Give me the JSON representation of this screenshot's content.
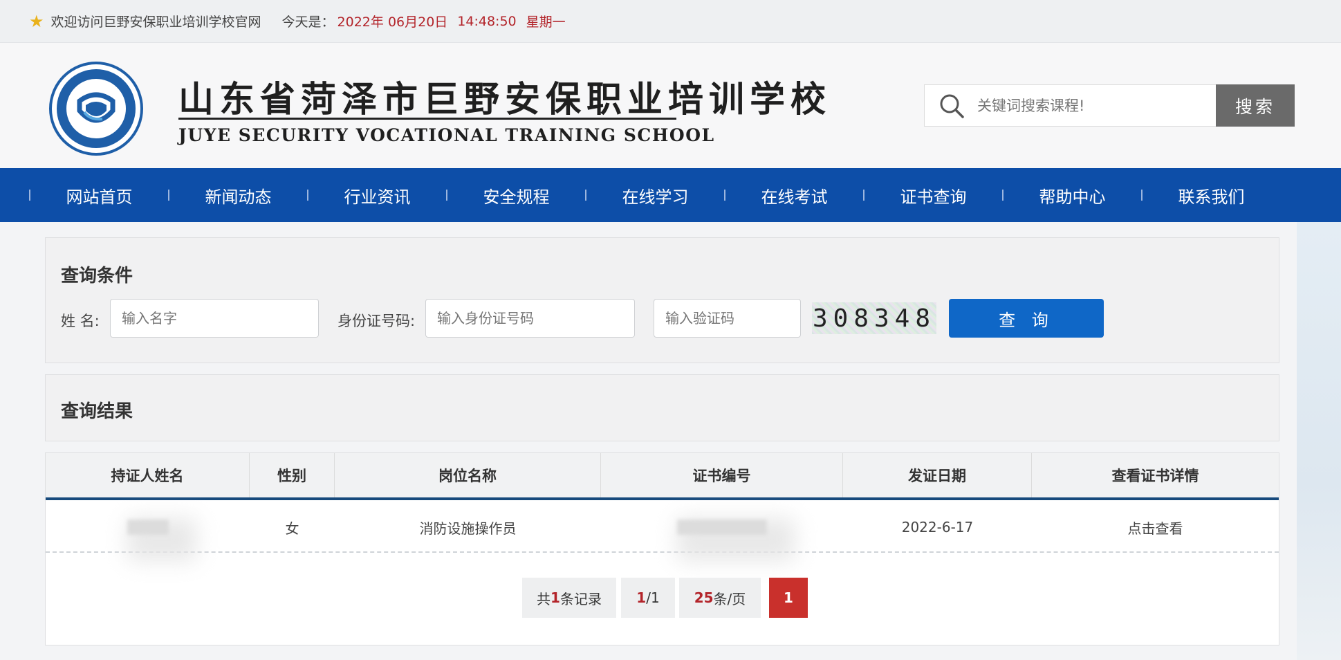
{
  "topbar": {
    "welcome": "欢迎访问巨野安保职业培训学校官网",
    "today_label": "今天是：",
    "date": "2022年 06月20日",
    "time": "14:48:50",
    "weekday": "星期一"
  },
  "header": {
    "school_name_cn": "山东省菏泽市巨野安保职业培训学校",
    "school_name_en": "JUYE SECURITY VOCATIONAL TRAINING SCHOOL",
    "search_placeholder": "关键词搜索课程!",
    "search_button": "搜索"
  },
  "nav": {
    "items": [
      "网站首页",
      "新闻动态",
      "行业资讯",
      "安全规程",
      "在线学习",
      "在线考试",
      "证书查询",
      "帮助中心",
      "联系我们"
    ]
  },
  "query": {
    "title": "查询条件",
    "name_label": "姓 名:",
    "name_placeholder": "输入名字",
    "id_label": "身份证号码:",
    "id_placeholder": "输入身份证号码",
    "captcha_placeholder": "输入验证码",
    "captcha_code": "308348",
    "submit": "查 询"
  },
  "results": {
    "title": "查询结果",
    "columns": [
      "持证人姓名",
      "性别",
      "岗位名称",
      "证书编号",
      "发证日期",
      "查看证书详情"
    ],
    "rows": [
      {
        "name": "",
        "gender": "女",
        "position": "消防设施操作员",
        "cert_no": "",
        "date": "2022-6-17",
        "detail": "点击查看"
      }
    ],
    "pager": {
      "total_prefix": "共",
      "total": "1",
      "total_suffix": "条记录",
      "page_current": "1",
      "page_total": "/1",
      "per_page": "25",
      "per_page_suffix": "条/页",
      "page_button": "1"
    }
  },
  "colors": {
    "nav_bg": "#0d4ea8",
    "query_button": "#0f67c7",
    "date_red": "#b3242a",
    "active_page": "#c9302c"
  }
}
